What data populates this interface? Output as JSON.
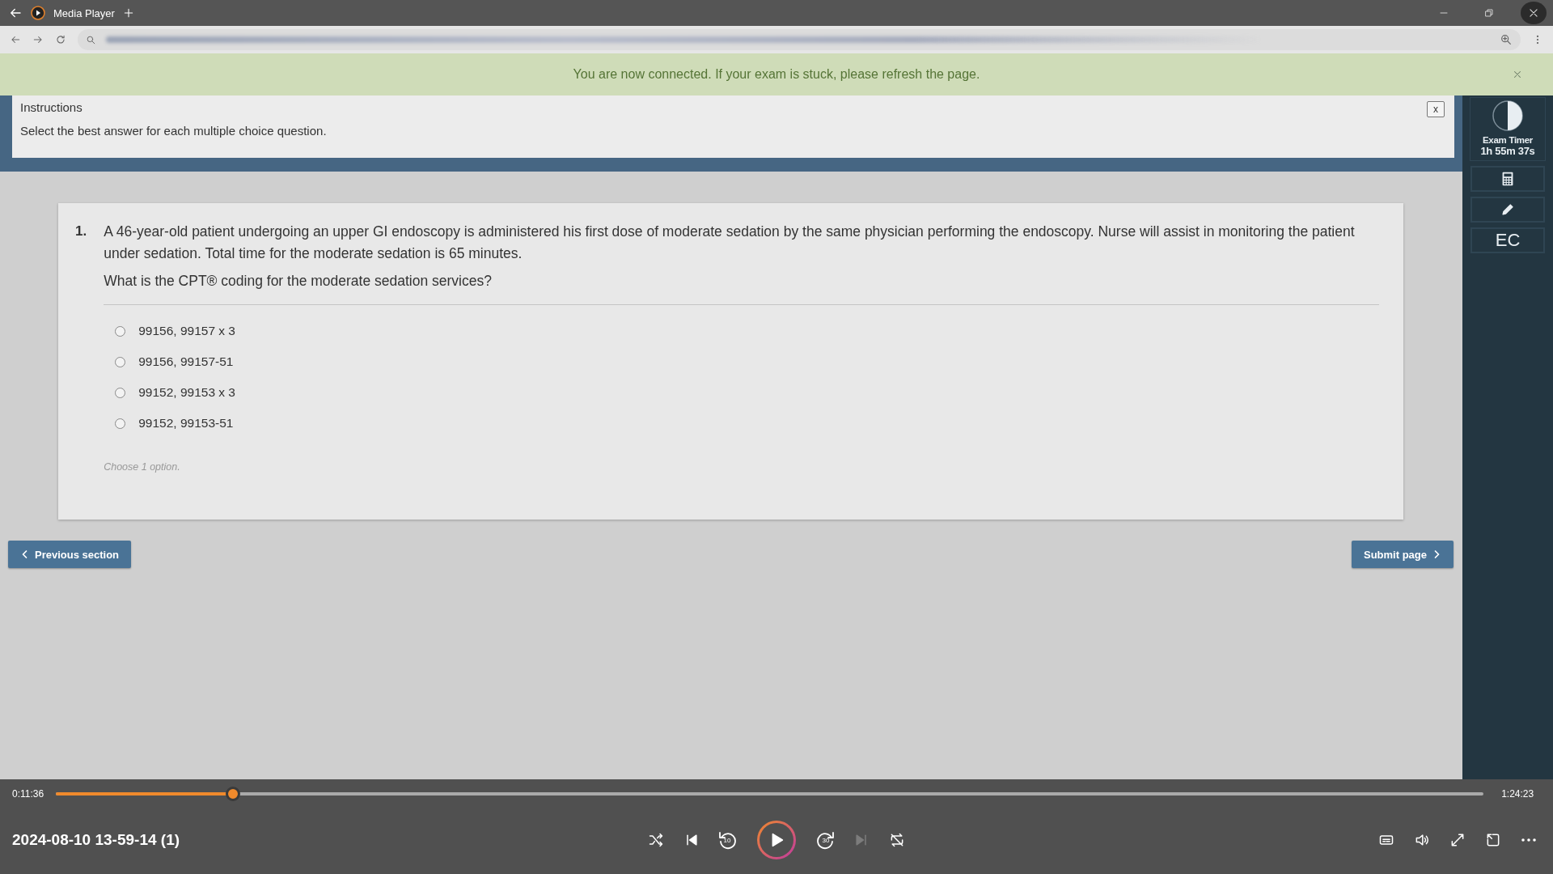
{
  "window": {
    "title": "Media Player"
  },
  "banner": {
    "message": "You are now connected. If your exam is stuck, please refresh the page."
  },
  "instructions": {
    "title": "Instructions",
    "text": "Select the best answer for each multiple choice question.",
    "close": "x"
  },
  "question": {
    "number": "1.",
    "text": "A 46-year-old patient undergoing an upper GI endoscopy is administered his first dose of moderate sedation by the same physician performing the endoscopy. Nurse will assist in monitoring the patient under sedation. Total time for the moderate sedation is 65 minutes.",
    "prompt": "What is the CPT® coding for the moderate sedation services?",
    "options": [
      {
        "label": "99156, 99157 x 3",
        "selected": false
      },
      {
        "label": "99156, 99157-51",
        "selected": false
      },
      {
        "label": "99152, 99153 x 3",
        "selected": false
      },
      {
        "label": "99152, 99153-51",
        "selected": false
      }
    ],
    "hint": "Choose 1 option."
  },
  "nav": {
    "previous": "Previous section",
    "submit": "Submit page"
  },
  "sidebar": {
    "timer_label": "Exam Timer",
    "timer_value": "1h 55m 37s",
    "tools": [
      {
        "kind": "calculator"
      },
      {
        "kind": "pencil"
      },
      {
        "kind": "text",
        "label": "EC"
      }
    ]
  },
  "player": {
    "elapsed": "0:11:36",
    "duration": "1:24:23",
    "progress": {
      "level": 0.124
    },
    "title": "2024-08-10 13-59-14 (1)",
    "controls": [
      {
        "kind": "shuffle",
        "disabled": false
      },
      {
        "kind": "previous",
        "disabled": false
      },
      {
        "kind": "rewind",
        "label": "10",
        "disabled": false
      },
      {
        "kind": "play",
        "disabled": false
      },
      {
        "kind": "forward",
        "label": "30",
        "disabled": false
      },
      {
        "kind": "next",
        "disabled": true
      },
      {
        "kind": "repeat",
        "disabled": false
      }
    ],
    "tools": [
      {
        "kind": "captions"
      },
      {
        "kind": "volume"
      },
      {
        "kind": "fullscreen"
      },
      {
        "kind": "miniplayer"
      },
      {
        "kind": "more"
      }
    ]
  }
}
